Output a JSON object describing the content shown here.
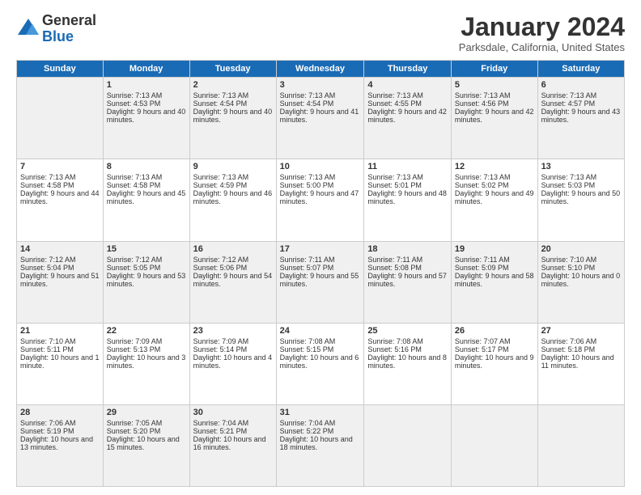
{
  "logo": {
    "general": "General",
    "blue": "Blue"
  },
  "title": "January 2024",
  "location": "Parksdale, California, United States",
  "headers": [
    "Sunday",
    "Monday",
    "Tuesday",
    "Wednesday",
    "Thursday",
    "Friday",
    "Saturday"
  ],
  "weeks": [
    [
      {
        "date": "",
        "sunrise": "",
        "sunset": "",
        "daylight": ""
      },
      {
        "date": "1",
        "sunrise": "Sunrise: 7:13 AM",
        "sunset": "Sunset: 4:53 PM",
        "daylight": "Daylight: 9 hours and 40 minutes."
      },
      {
        "date": "2",
        "sunrise": "Sunrise: 7:13 AM",
        "sunset": "Sunset: 4:54 PM",
        "daylight": "Daylight: 9 hours and 40 minutes."
      },
      {
        "date": "3",
        "sunrise": "Sunrise: 7:13 AM",
        "sunset": "Sunset: 4:54 PM",
        "daylight": "Daylight: 9 hours and 41 minutes."
      },
      {
        "date": "4",
        "sunrise": "Sunrise: 7:13 AM",
        "sunset": "Sunset: 4:55 PM",
        "daylight": "Daylight: 9 hours and 42 minutes."
      },
      {
        "date": "5",
        "sunrise": "Sunrise: 7:13 AM",
        "sunset": "Sunset: 4:56 PM",
        "daylight": "Daylight: 9 hours and 42 minutes."
      },
      {
        "date": "6",
        "sunrise": "Sunrise: 7:13 AM",
        "sunset": "Sunset: 4:57 PM",
        "daylight": "Daylight: 9 hours and 43 minutes."
      }
    ],
    [
      {
        "date": "7",
        "sunrise": "Sunrise: 7:13 AM",
        "sunset": "Sunset: 4:58 PM",
        "daylight": "Daylight: 9 hours and 44 minutes."
      },
      {
        "date": "8",
        "sunrise": "Sunrise: 7:13 AM",
        "sunset": "Sunset: 4:58 PM",
        "daylight": "Daylight: 9 hours and 45 minutes."
      },
      {
        "date": "9",
        "sunrise": "Sunrise: 7:13 AM",
        "sunset": "Sunset: 4:59 PM",
        "daylight": "Daylight: 9 hours and 46 minutes."
      },
      {
        "date": "10",
        "sunrise": "Sunrise: 7:13 AM",
        "sunset": "Sunset: 5:00 PM",
        "daylight": "Daylight: 9 hours and 47 minutes."
      },
      {
        "date": "11",
        "sunrise": "Sunrise: 7:13 AM",
        "sunset": "Sunset: 5:01 PM",
        "daylight": "Daylight: 9 hours and 48 minutes."
      },
      {
        "date": "12",
        "sunrise": "Sunrise: 7:13 AM",
        "sunset": "Sunset: 5:02 PM",
        "daylight": "Daylight: 9 hours and 49 minutes."
      },
      {
        "date": "13",
        "sunrise": "Sunrise: 7:13 AM",
        "sunset": "Sunset: 5:03 PM",
        "daylight": "Daylight: 9 hours and 50 minutes."
      }
    ],
    [
      {
        "date": "14",
        "sunrise": "Sunrise: 7:12 AM",
        "sunset": "Sunset: 5:04 PM",
        "daylight": "Daylight: 9 hours and 51 minutes."
      },
      {
        "date": "15",
        "sunrise": "Sunrise: 7:12 AM",
        "sunset": "Sunset: 5:05 PM",
        "daylight": "Daylight: 9 hours and 53 minutes."
      },
      {
        "date": "16",
        "sunrise": "Sunrise: 7:12 AM",
        "sunset": "Sunset: 5:06 PM",
        "daylight": "Daylight: 9 hours and 54 minutes."
      },
      {
        "date": "17",
        "sunrise": "Sunrise: 7:11 AM",
        "sunset": "Sunset: 5:07 PM",
        "daylight": "Daylight: 9 hours and 55 minutes."
      },
      {
        "date": "18",
        "sunrise": "Sunrise: 7:11 AM",
        "sunset": "Sunset: 5:08 PM",
        "daylight": "Daylight: 9 hours and 57 minutes."
      },
      {
        "date": "19",
        "sunrise": "Sunrise: 7:11 AM",
        "sunset": "Sunset: 5:09 PM",
        "daylight": "Daylight: 9 hours and 58 minutes."
      },
      {
        "date": "20",
        "sunrise": "Sunrise: 7:10 AM",
        "sunset": "Sunset: 5:10 PM",
        "daylight": "Daylight: 10 hours and 0 minutes."
      }
    ],
    [
      {
        "date": "21",
        "sunrise": "Sunrise: 7:10 AM",
        "sunset": "Sunset: 5:11 PM",
        "daylight": "Daylight: 10 hours and 1 minute."
      },
      {
        "date": "22",
        "sunrise": "Sunrise: 7:09 AM",
        "sunset": "Sunset: 5:13 PM",
        "daylight": "Daylight: 10 hours and 3 minutes."
      },
      {
        "date": "23",
        "sunrise": "Sunrise: 7:09 AM",
        "sunset": "Sunset: 5:14 PM",
        "daylight": "Daylight: 10 hours and 4 minutes."
      },
      {
        "date": "24",
        "sunrise": "Sunrise: 7:08 AM",
        "sunset": "Sunset: 5:15 PM",
        "daylight": "Daylight: 10 hours and 6 minutes."
      },
      {
        "date": "25",
        "sunrise": "Sunrise: 7:08 AM",
        "sunset": "Sunset: 5:16 PM",
        "daylight": "Daylight: 10 hours and 8 minutes."
      },
      {
        "date": "26",
        "sunrise": "Sunrise: 7:07 AM",
        "sunset": "Sunset: 5:17 PM",
        "daylight": "Daylight: 10 hours and 9 minutes."
      },
      {
        "date": "27",
        "sunrise": "Sunrise: 7:06 AM",
        "sunset": "Sunset: 5:18 PM",
        "daylight": "Daylight: 10 hours and 11 minutes."
      }
    ],
    [
      {
        "date": "28",
        "sunrise": "Sunrise: 7:06 AM",
        "sunset": "Sunset: 5:19 PM",
        "daylight": "Daylight: 10 hours and 13 minutes."
      },
      {
        "date": "29",
        "sunrise": "Sunrise: 7:05 AM",
        "sunset": "Sunset: 5:20 PM",
        "daylight": "Daylight: 10 hours and 15 minutes."
      },
      {
        "date": "30",
        "sunrise": "Sunrise: 7:04 AM",
        "sunset": "Sunset: 5:21 PM",
        "daylight": "Daylight: 10 hours and 16 minutes."
      },
      {
        "date": "31",
        "sunrise": "Sunrise: 7:04 AM",
        "sunset": "Sunset: 5:22 PM",
        "daylight": "Daylight: 10 hours and 18 minutes."
      },
      {
        "date": "",
        "sunrise": "",
        "sunset": "",
        "daylight": ""
      },
      {
        "date": "",
        "sunrise": "",
        "sunset": "",
        "daylight": ""
      },
      {
        "date": "",
        "sunrise": "",
        "sunset": "",
        "daylight": ""
      }
    ]
  ]
}
